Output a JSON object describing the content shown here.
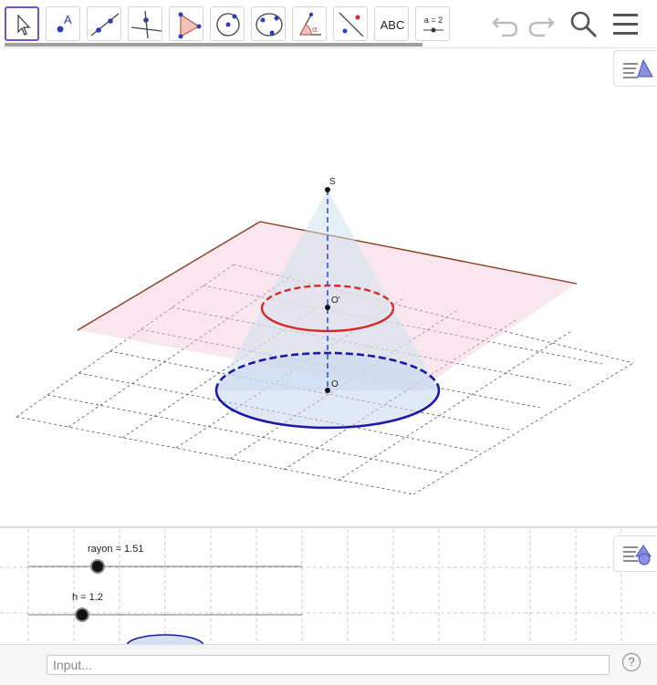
{
  "toolbar": {
    "tools": [
      {
        "name": "move",
        "label": ""
      },
      {
        "name": "point",
        "label": "A"
      },
      {
        "name": "line",
        "label": ""
      },
      {
        "name": "perpendicular-line",
        "label": ""
      },
      {
        "name": "polygon",
        "label": ""
      },
      {
        "name": "circle-with-center",
        "label": ""
      },
      {
        "name": "circle-through-points",
        "label": ""
      },
      {
        "name": "angle",
        "label": "α"
      },
      {
        "name": "reflect-about-line",
        "label": ""
      },
      {
        "name": "text",
        "label": "ABC"
      },
      {
        "name": "slider",
        "label": "a = 2"
      }
    ],
    "right_icons": [
      "undo-icon",
      "redo-icon",
      "search-icon",
      "menu-icon"
    ]
  },
  "view3d": {
    "points": {
      "apex": "S",
      "top_center": "O'",
      "base_center": "O"
    },
    "colors": {
      "plane": "#f7d6e4",
      "plane_edge": "#8b3a1a",
      "top_circle": "#d52a2a",
      "base_circle": "#1a1aa6",
      "axis": "#3a4fd0"
    }
  },
  "view2d": {
    "sliders": [
      {
        "label": "rayon = 1.51",
        "value": 1.51
      },
      {
        "label": "h = 1.2",
        "value": 1.2
      }
    ]
  },
  "input_bar": {
    "placeholder": "Input...",
    "help": "?"
  }
}
